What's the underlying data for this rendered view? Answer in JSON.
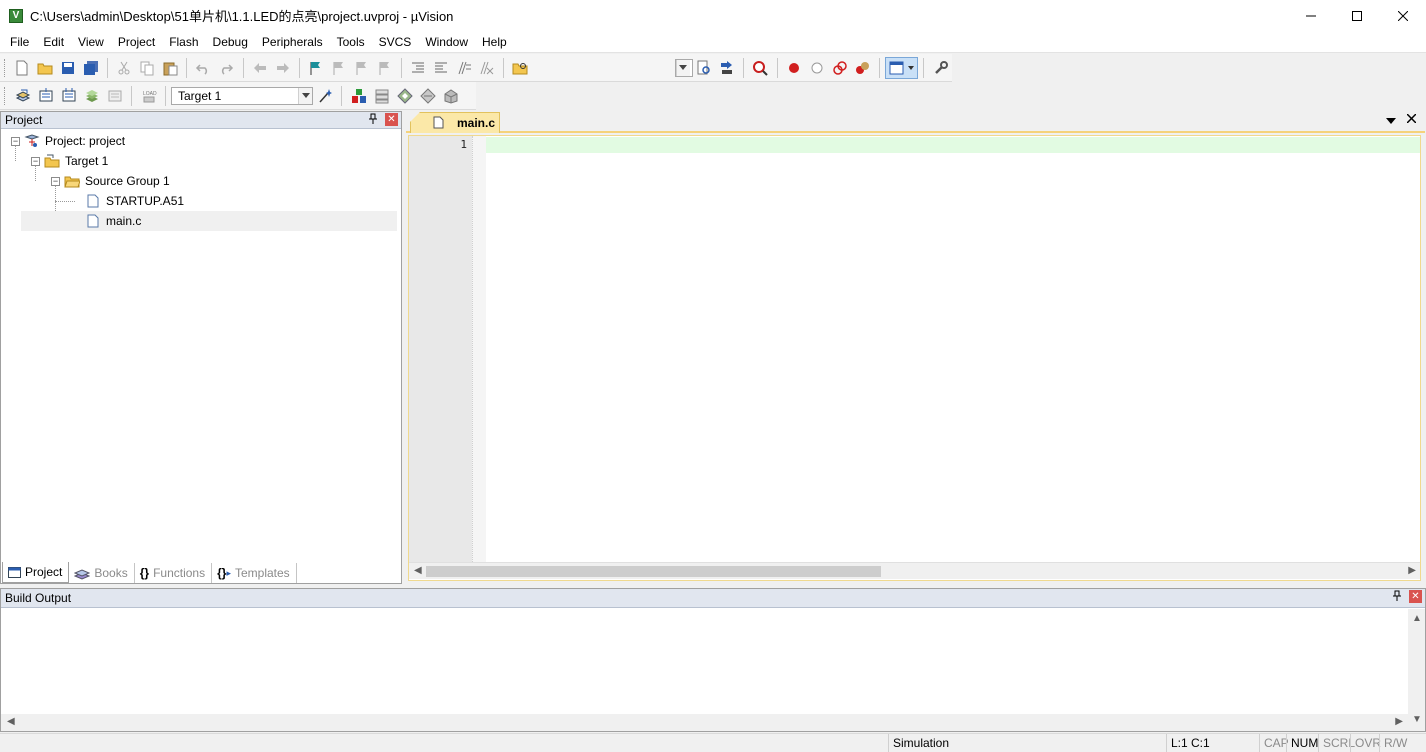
{
  "window": {
    "title": "C:\\Users\\admin\\Desktop\\51单片机\\1.1.LED的点亮\\project.uvproj - µVision",
    "app_icon_letter": "V"
  },
  "menu": [
    "File",
    "Edit",
    "View",
    "Project",
    "Flash",
    "Debug",
    "Peripherals",
    "Tools",
    "SVCS",
    "Window",
    "Help"
  ],
  "toolbar2": {
    "target_value": "Target 1"
  },
  "project_panel": {
    "title": "Project",
    "tree": {
      "root": "Project: project",
      "target": "Target 1",
      "group": "Source Group 1",
      "files": [
        "STARTUP.A51",
        "main.c"
      ]
    },
    "tabs": [
      "Project",
      "Books",
      "Functions",
      "Templates"
    ]
  },
  "editor": {
    "tab_label": "main.c",
    "line_numbers": [
      "1"
    ]
  },
  "build_output": {
    "title": "Build Output"
  },
  "status": {
    "mode": "Simulation",
    "position": "L:1 C:1",
    "indicators": [
      "CAP",
      "NUM",
      "SCRL",
      "OVR",
      "R/W"
    ]
  },
  "colors": {
    "tab_active": "#fbe8a8",
    "current_line": "#e2fbe2",
    "panel_header": "#e1e6ef"
  }
}
